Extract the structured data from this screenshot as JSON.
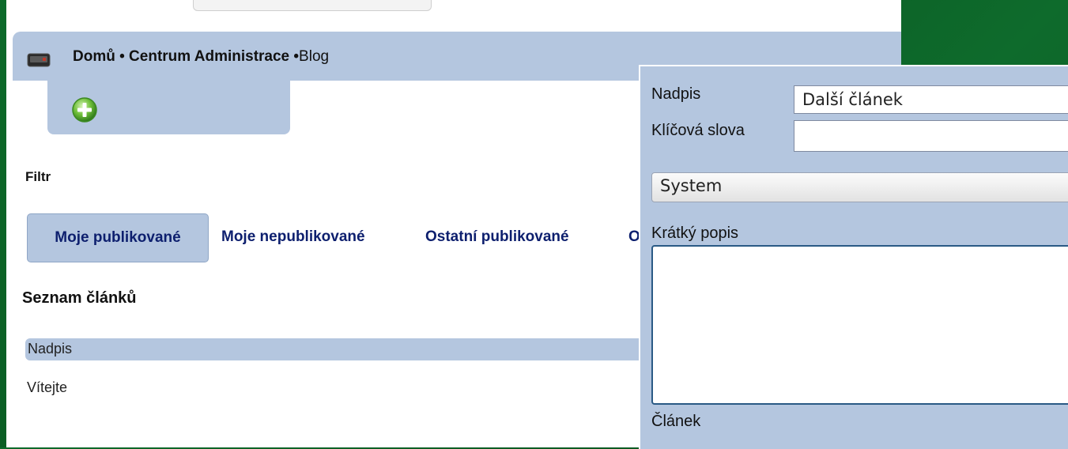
{
  "breadcrumb": {
    "home": "Domů",
    "sep1": " • ",
    "admin": "Centrum Administrace",
    "sep2": " •",
    "blog": "Blog"
  },
  "filter": {
    "label": "Filtr",
    "tabs": [
      {
        "label": "Moje publikované"
      },
      {
        "label": "Moje nepublikované"
      },
      {
        "label": "Ostatní publikované"
      },
      {
        "label": "O"
      }
    ]
  },
  "list": {
    "title": "Seznam článků",
    "column_header": "Nadpis",
    "rows": [
      "Vítejte"
    ]
  },
  "form": {
    "title_label": "Nadpis",
    "title_value": "Další článek",
    "keywords_label": "Klíčová slova",
    "keywords_value": "",
    "category_value": "System",
    "short_label": "Krátký popis",
    "short_value": "",
    "article_label": "Článek"
  }
}
